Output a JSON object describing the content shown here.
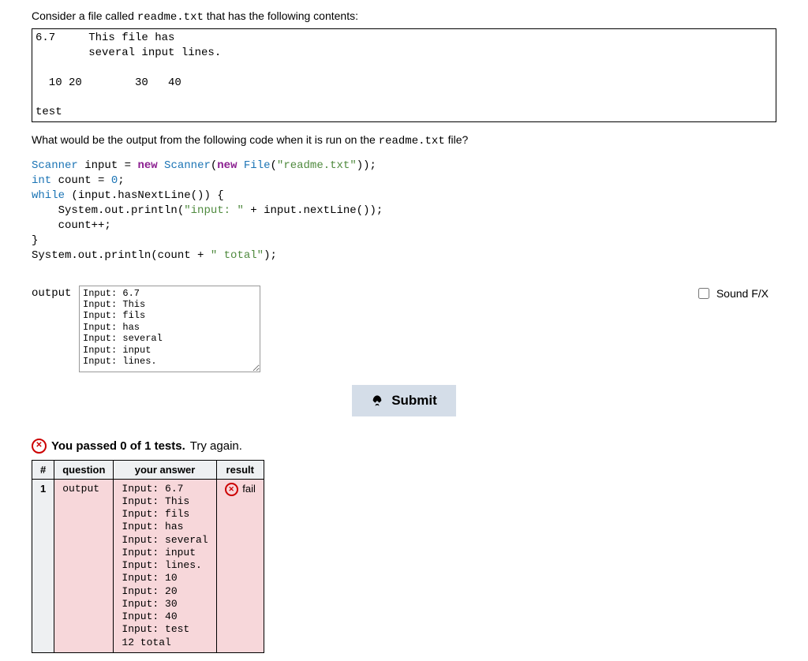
{
  "intro_prefix": "Consider a file called ",
  "intro_filename": "readme.txt",
  "intro_suffix": " that has the following contents:",
  "file_contents": "6.7     This file has\n        several input lines.\n\n  10 20        30   40\n\ntest",
  "question_prefix": "What would be the output from the following code when it is run on the ",
  "question_filename": "readme.txt",
  "question_suffix": " file?",
  "code": {
    "l1a": "Scanner",
    "l1b": " input = ",
    "l1c": "new",
    "l1d": " Scanner",
    "l1e": "(",
    "l1f": "new",
    "l1g": " File",
    "l1h": "(",
    "l1i": "\"readme.txt\"",
    "l1j": "));",
    "l2a": "int",
    "l2b": " count = ",
    "l2c": "0",
    "l2d": ";",
    "l3a": "while",
    "l3b": " (input.hasNextLine()) {",
    "l4a": "    System.out.println(",
    "l4b": "\"input: \"",
    "l4c": " + input.nextLine());",
    "l5a": "    count++;",
    "l6a": "}",
    "l7a": "System.out.println(count + ",
    "l7b": "\" total\"",
    "l7c": ");"
  },
  "answer_label": "output",
  "answer_value": "Input: 6.7\nInput: This\nInput: fils\nInput: has\nInput: several\nInput: input\nInput: lines.",
  "soundfx_label": "Sound F/X",
  "submit_label": "Submit",
  "result_bold": "You passed 0 of 1 tests.",
  "result_tail": " Try again.",
  "table": {
    "h1": "#",
    "h2": "question",
    "h3": "your answer",
    "h4": "result",
    "row": {
      "num": "1",
      "q": "output",
      "ans": "Input: 6.7\nInput: This\nInput: fils\nInput: has\nInput: several\nInput: input\nInput: lines.\nInput: 10\nInput: 20\nInput: 30\nInput: 40\nInput: test\n12 total",
      "res": "fail"
    }
  }
}
